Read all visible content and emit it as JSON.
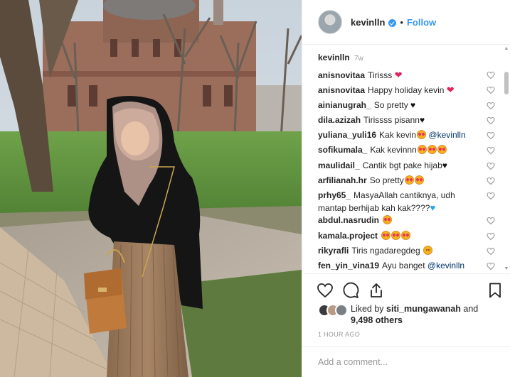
{
  "post": {
    "photo_alt": "Woman in beige hijab and black hooded jacket holding a tan handbag in a park in front of a domed brick building"
  },
  "header": {
    "username": "kevinlln",
    "separator": "•",
    "follow_label": "Follow",
    "avatar_icon": "profile-avatar",
    "verified_icon": "verified-badge-icon"
  },
  "caption": {
    "username": "kevinlln",
    "time": "7w"
  },
  "comments": [
    {
      "user": "anisnovitaa",
      "parts": [
        {
          "t": "Tirisss "
        }
      ],
      "emojis": [
        "red-heart"
      ]
    },
    {
      "user": "anisnovitaa",
      "parts": [
        {
          "t": "Happy holiday kevin "
        }
      ],
      "emojis": [
        "red-heart"
      ]
    },
    {
      "user": "ainianugrah_",
      "parts": [
        {
          "t": "So pretty "
        }
      ],
      "emojis": [
        "black-heart"
      ]
    },
    {
      "user": "dila.azizah",
      "parts": [
        {
          "t": "Tirissss pisann"
        }
      ],
      "emojis": [
        "black-heart"
      ]
    },
    {
      "user": "yuliana_yuli16",
      "parts": [
        {
          "t": "Kak kevin"
        }
      ],
      "emojis": [
        "heart-eyes"
      ],
      "mention": "@kevinlln"
    },
    {
      "user": "sofikumala_",
      "parts": [
        {
          "t": "Kak kevinnn"
        }
      ],
      "emojis": [
        "heart-eyes",
        "heart-eyes",
        "heart-eyes"
      ]
    },
    {
      "user": "maulidail_",
      "parts": [
        {
          "t": "Cantik bgt pake hijab"
        }
      ],
      "emojis": [
        "black-heart"
      ]
    },
    {
      "user": "arfilianah.hr",
      "parts": [
        {
          "t": "So pretty"
        }
      ],
      "emojis": [
        "heart-eyes",
        "heart-eyes"
      ]
    },
    {
      "user": "prhy65_",
      "parts": [
        {
          "t": "MasyaAllah cantiknya, udh mantap berhijab kah kak????"
        }
      ],
      "emojis": [
        "blue-heart"
      ]
    },
    {
      "user": "abdul.nasrudin",
      "parts": [
        {
          "t": ""
        }
      ],
      "emojis": [
        "heart-eyes"
      ]
    },
    {
      "user": "kamala.project",
      "parts": [
        {
          "t": ""
        }
      ],
      "emojis": [
        "heart-eyes",
        "heart-eyes",
        "heart-eyes"
      ]
    },
    {
      "user": "rikyrafli",
      "parts": [
        {
          "t": "Tiris ngadaregdeg "
        }
      ],
      "emojis": [
        "grinning"
      ]
    },
    {
      "user": "fen_yin_vina19",
      "parts": [
        {
          "t": "Ayu banget "
        }
      ],
      "emojis": [],
      "mention": "@kevinlln"
    }
  ],
  "actions": {
    "like_icon": "heart-outline-icon",
    "comment_icon": "comment-bubble-icon",
    "share_icon": "share-arrow-icon",
    "save_icon": "bookmark-icon"
  },
  "likes": {
    "prefix": "Liked by ",
    "liker": "siti_mungawanah",
    "and": " and",
    "others": "9,498 others"
  },
  "posted_time": "1 HOUR AGO",
  "add_comment": {
    "placeholder": "Add a comment..."
  },
  "colors": {
    "link_blue": "#3897f0",
    "text": "#262626",
    "muted": "#999999",
    "border": "#efefef",
    "mention": "#003569"
  }
}
